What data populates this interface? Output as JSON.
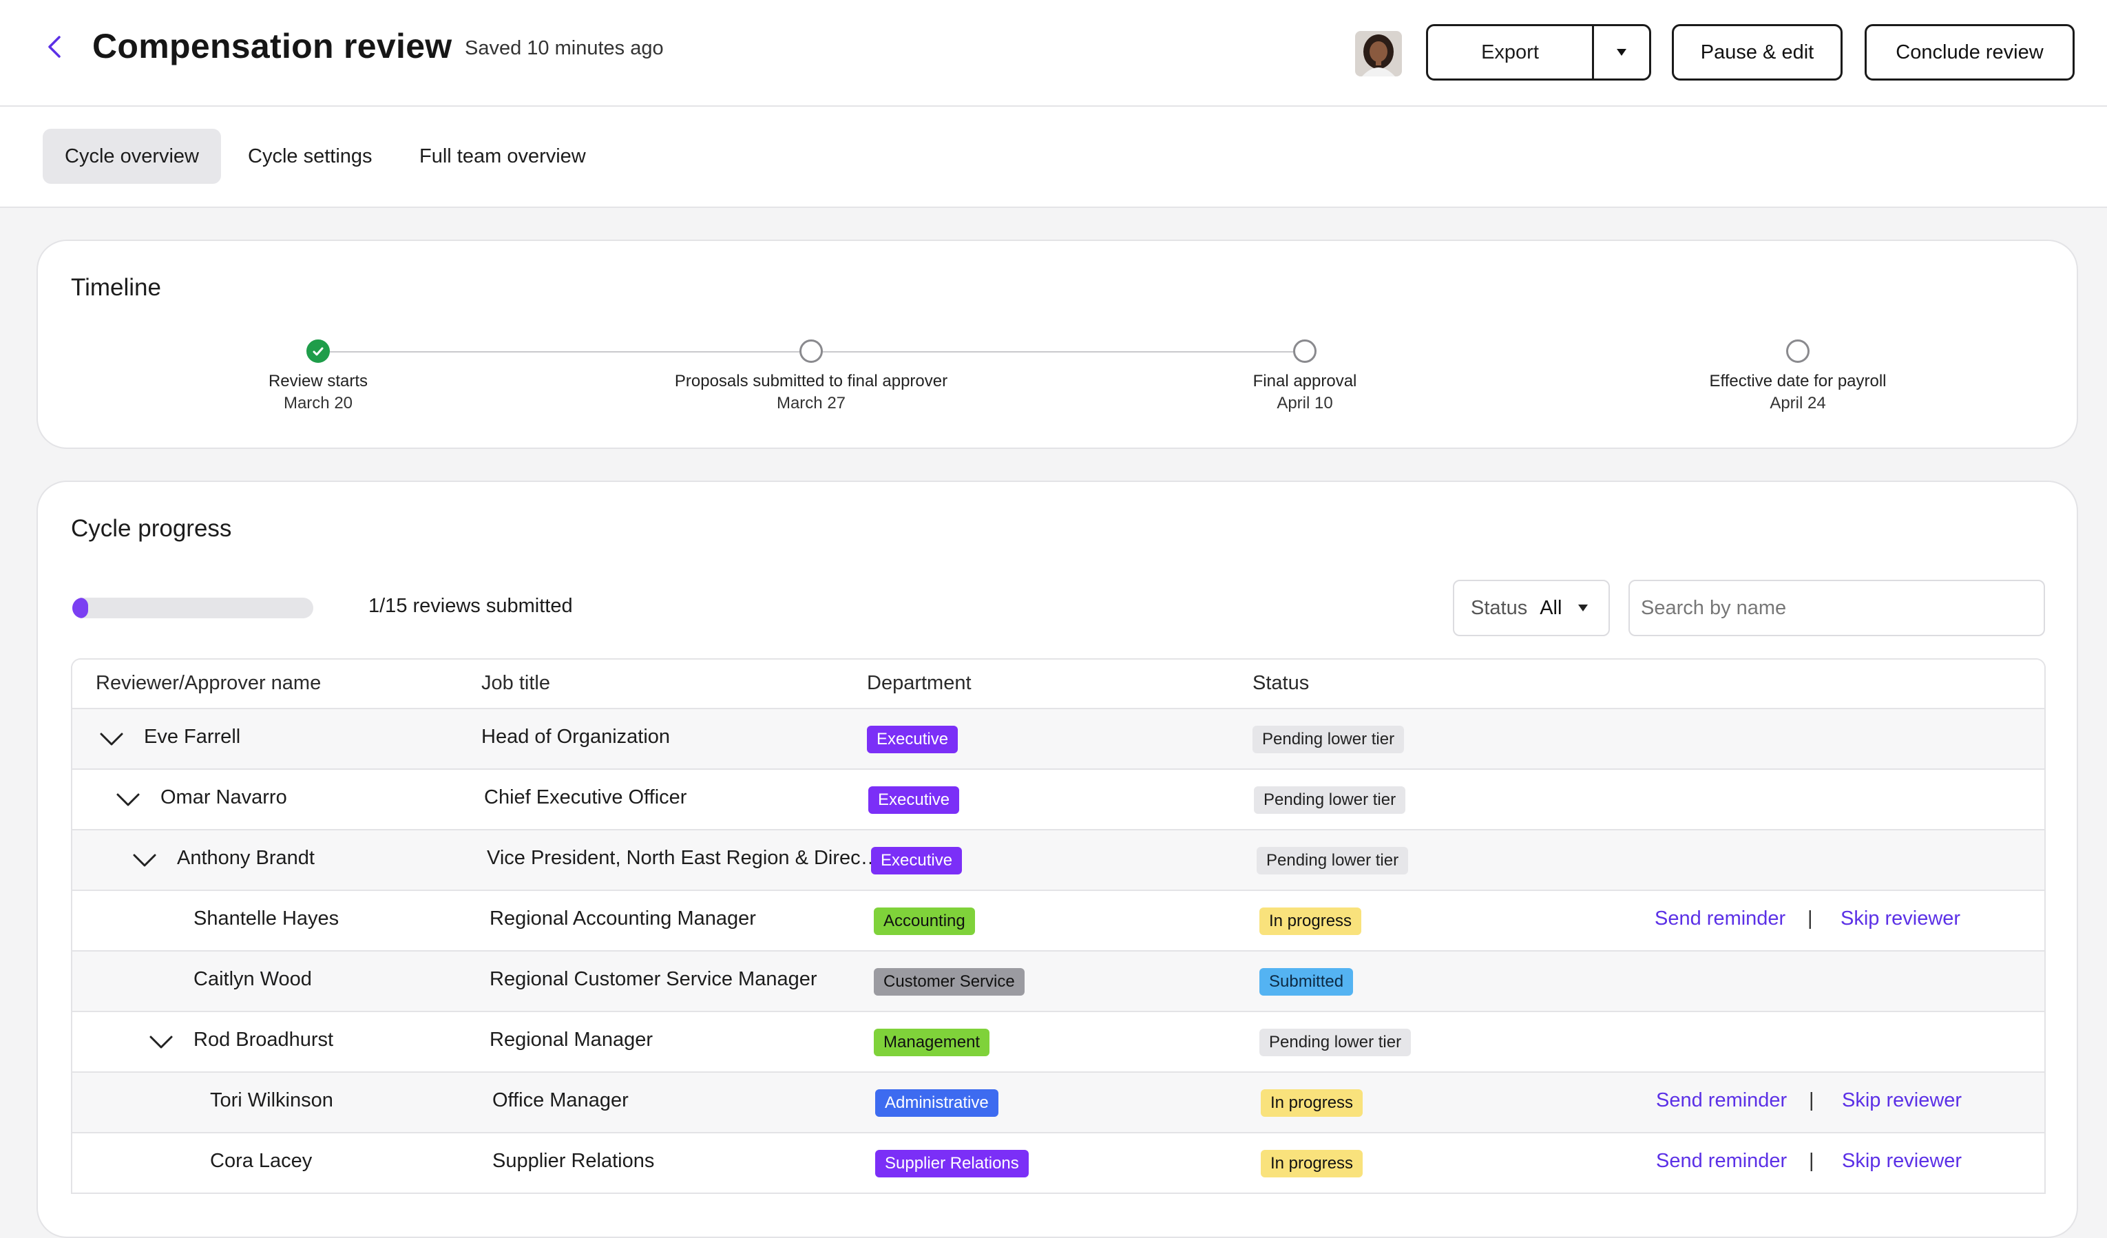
{
  "header": {
    "title": "Compensation review",
    "saved_status": "Saved 10 minutes ago",
    "export_label": "Export",
    "pause_label": "Pause & edit",
    "conclude_label": "Conclude review"
  },
  "tabs": [
    {
      "label": "Cycle overview",
      "active": true
    },
    {
      "label": "Cycle settings",
      "active": false
    },
    {
      "label": "Full team overview",
      "active": false
    }
  ],
  "timeline": {
    "title": "Timeline",
    "steps": [
      {
        "label": "Review starts",
        "date": "March 20",
        "done": true
      },
      {
        "label": "Proposals submitted to final approver",
        "date": "March 27",
        "done": false
      },
      {
        "label": "Final approval",
        "date": "April 10",
        "done": false
      },
      {
        "label": "Effective date for payroll",
        "date": "April 24",
        "done": false
      }
    ]
  },
  "progress": {
    "title": "Cycle progress",
    "submitted": 1,
    "total": 15,
    "text": "1/15 reviews submitted",
    "status_filter_label": "Status",
    "status_filter_value": "All",
    "search_placeholder": "Search by name"
  },
  "table": {
    "columns": [
      "Reviewer/Approver name",
      "Job title",
      "Department",
      "Status"
    ],
    "send_reminder_label": "Send reminder",
    "skip_reviewer_label": "Skip reviewer",
    "separator": "|",
    "rows": [
      {
        "name": "Eve Farrell",
        "title": "Head of Organization",
        "department": "Executive",
        "status": "Pending lower tier"
      },
      {
        "name": "Omar Navarro",
        "title": "Chief Executive Officer",
        "department": "Executive",
        "status": "Pending lower tier"
      },
      {
        "name": "Anthony Brandt",
        "title": "Vice President, North East Region & Direc…",
        "department": "Executive",
        "status": "Pending lower tier"
      },
      {
        "name": "Shantelle Hayes",
        "title": "Regional Accounting Manager",
        "department": "Accounting",
        "status": "In progress"
      },
      {
        "name": "Caitlyn Wood",
        "title": "Regional Customer Service Manager",
        "department": "Customer Service",
        "status": "Submitted"
      },
      {
        "name": "Rod Broadhurst",
        "title": "Regional Manager",
        "department": "Management",
        "status": "Pending lower tier"
      },
      {
        "name": "Tori Wilkinson",
        "title": "Office Manager",
        "department": "Administrative",
        "status": "In progress"
      },
      {
        "name": "Cora Lacey",
        "title": "Supplier Relations",
        "department": "Supplier Relations",
        "status": "In progress"
      }
    ]
  },
  "colors": {
    "accent": "#7b3ff2",
    "link": "#5b30e6",
    "done": "#1f9d4a",
    "dept_executive": "#7b2ff7",
    "dept_accounting": "#7fd23a",
    "dept_customer_service": "#9b9ba1",
    "dept_management": "#7fd23a",
    "dept_administrative": "#3d6bf0",
    "dept_supplier_relations": "#7b2ff7",
    "status_pending": "#e6e6e9",
    "status_in_progress": "#f9e27c",
    "status_submitted": "#54b3f2"
  },
  "icons": {
    "back": "chevron-left-icon",
    "caret": "caret-down-icon",
    "expand": "chevron-down-icon",
    "check": "check-icon"
  }
}
